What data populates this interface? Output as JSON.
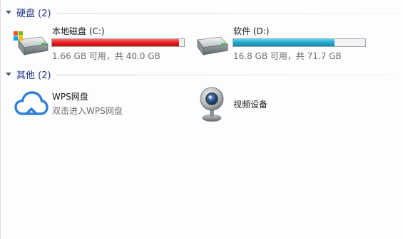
{
  "groups": {
    "hard_disks": {
      "title": "硬盘 (2)",
      "drives": [
        {
          "name": "本地磁盘 (C:)",
          "free_total": "1.66 GB 可用，共 40.0 GB",
          "used_fraction": 0.96,
          "bar_color": "#e3181b",
          "icon": "windows-hard-drive-icon"
        },
        {
          "name": "软件 (D:)",
          "free_total": "16.8 GB 可用，共 71.7 GB",
          "used_fraction": 0.77,
          "bar_color": "#1da3c8",
          "icon": "hard-drive-icon"
        }
      ]
    },
    "other": {
      "title": "其他 (2)",
      "items": [
        {
          "name": "WPS网盘",
          "subtitle": "双击进入WPS网盘",
          "icon": "cloud-icon"
        },
        {
          "name": "视频设备",
          "icon": "webcam-icon"
        }
      ]
    }
  }
}
